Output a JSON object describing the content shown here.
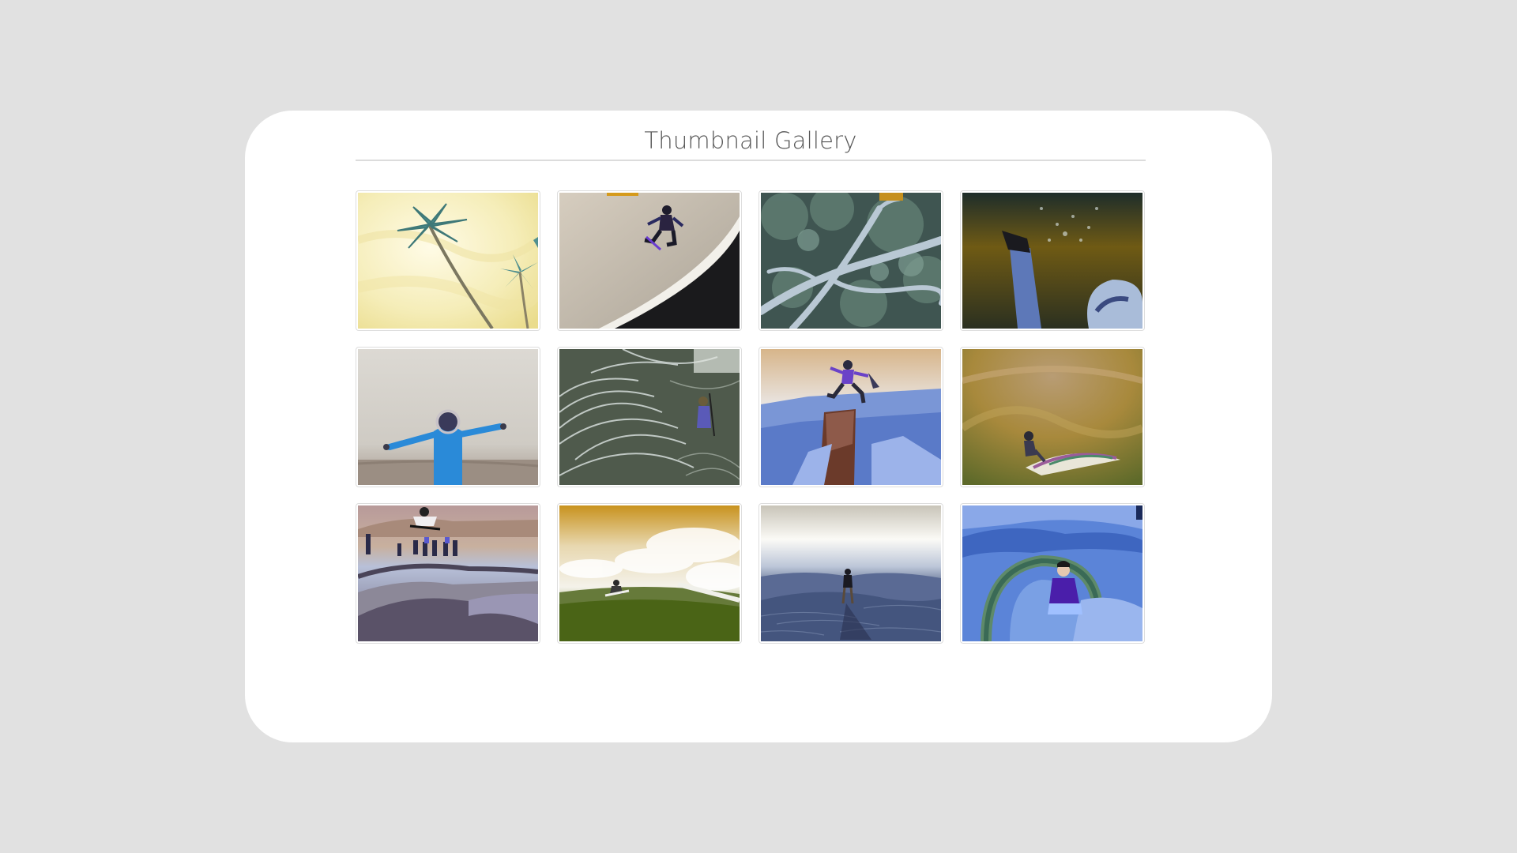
{
  "gallery": {
    "title": "Thumbnail Gallery",
    "colors": {
      "page_background": "#e1e1e1",
      "card_background": "#ffffff",
      "title_text": "#555555",
      "thumb_border": "#dddddd"
    }
  }
}
